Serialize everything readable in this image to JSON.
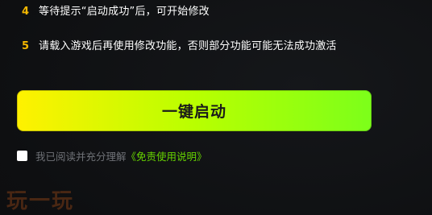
{
  "steps": [
    {
      "number": "4",
      "text": "等待提示“启动成功”后，可开始修改"
    },
    {
      "number": "5",
      "text": "请载入游戏后再使用修改功能，否则部分功能可能无法成功激活"
    }
  ],
  "launch_button": {
    "label": "一键启动"
  },
  "agreement": {
    "checked": false,
    "text": "我已阅读并充分理解",
    "link_text": "《免责使用说明》"
  },
  "watermark": {
    "text": "玩一玩"
  },
  "colors": {
    "background": "#0f1012",
    "step_number": "#f6b800",
    "button_gradient_start": "#fff100",
    "button_gradient_end": "#7cff1a",
    "link": "#67d400"
  }
}
